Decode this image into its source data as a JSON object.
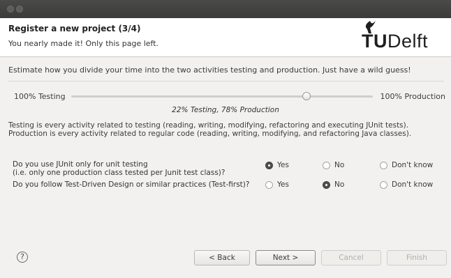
{
  "window": {
    "title_buttons": [
      "close",
      "minimize"
    ]
  },
  "header": {
    "title": "Register a new project (3/4)",
    "subtitle": "You nearly made it! Only this page left.",
    "logo": {
      "prefix": "T",
      "accent": "U",
      "suffix": "Delft",
      "icon": "flame-icon"
    }
  },
  "estimate": {
    "prompt": "Estimate how you divide your time into the two activities testing and production. Just have a wild guess!",
    "slider": {
      "left_label": "100% Testing",
      "right_label": "100% Production",
      "value_label": "22% Testing, 78% Production",
      "production_fraction": 0.78
    },
    "explanation_line1": "Testing is every activity related to testing (reading, writing, modifying, refactoring and executing JUnit tests).",
    "explanation_line2": "Production is every activity related to regular code (reading, writing, modifying, and refactoring Java classes)."
  },
  "questions": [
    {
      "line1": "Do you use JUnit only for unit testing",
      "line2": "(i.e. only one production class tested per Junit test class)?",
      "options": [
        "Yes",
        "No",
        "Don't know"
      ],
      "selected": "Yes"
    },
    {
      "line1": "Do you follow Test-Driven Design or similar practices (Test-first)?",
      "line2": "",
      "options": [
        "Yes",
        "No",
        "Don't know"
      ],
      "selected": "No"
    }
  ],
  "footer": {
    "help_icon": "?",
    "back_label": "< Back",
    "next_label": "Next >",
    "cancel_label": "Cancel",
    "finish_label": "Finish"
  },
  "colors": {
    "selected_radio": "#4f4f4d",
    "titlebar": "#3b3b39"
  }
}
